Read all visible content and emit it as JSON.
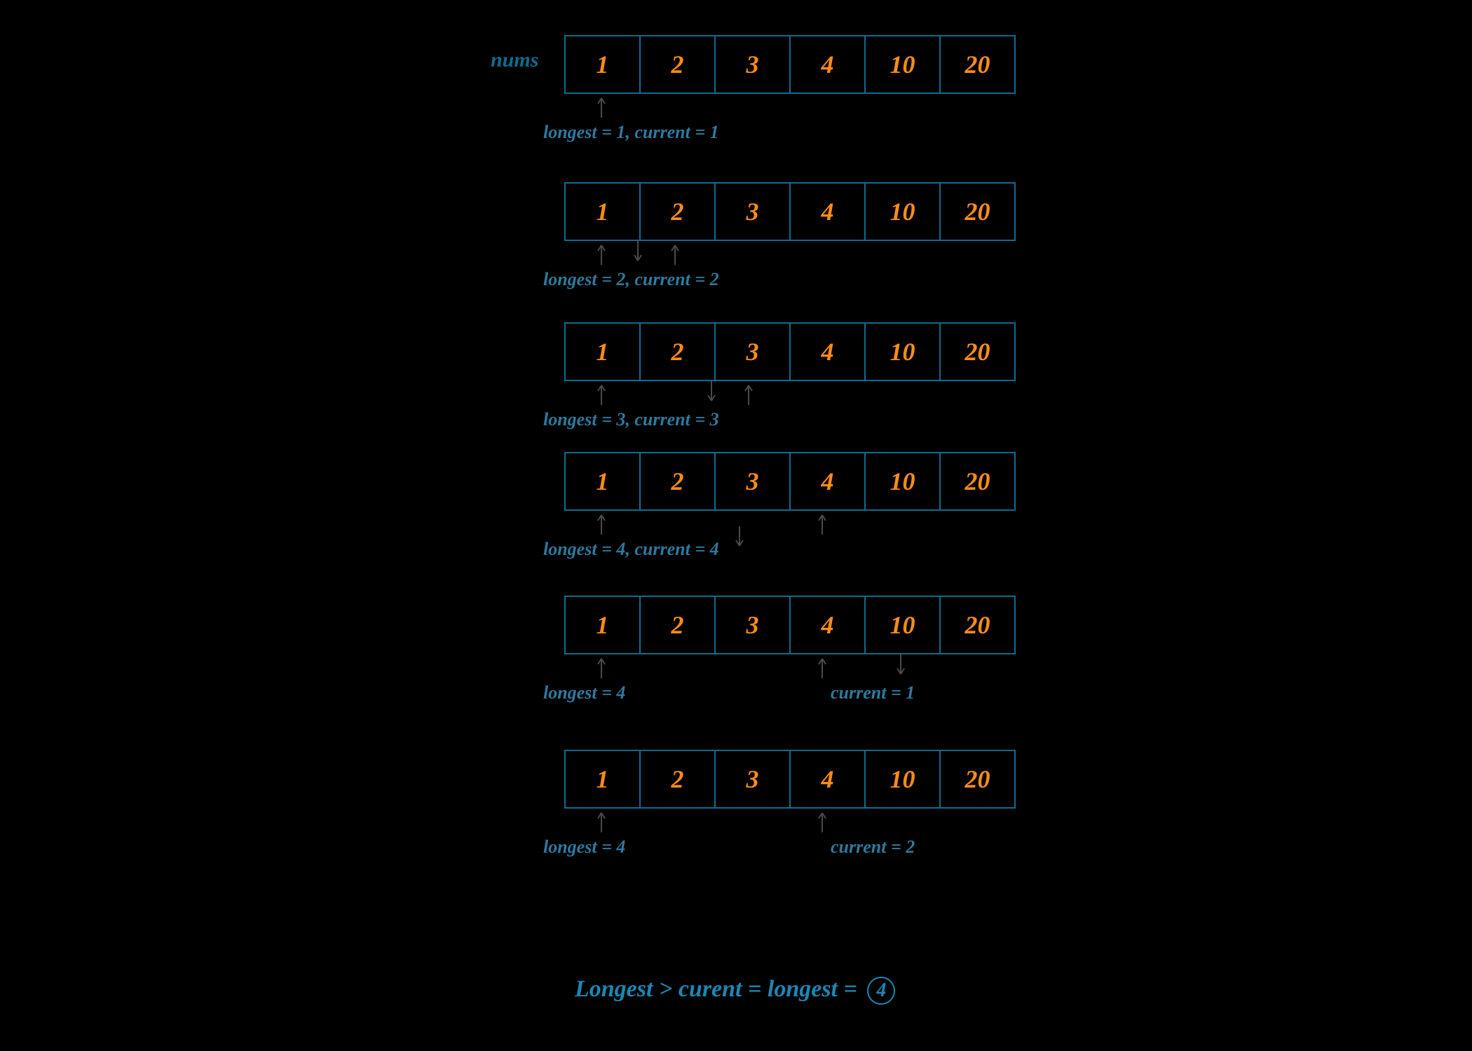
{
  "array_label": "nums",
  "cells": [
    "1",
    "2",
    "3",
    "4",
    "10",
    "20"
  ],
  "steps": [
    {
      "caption": "longest = 1, current = 1",
      "arrow_up_idx": [
        0
      ],
      "arrow_down_idx": [],
      "caption_split": null
    },
    {
      "caption": "longest = 2, current = 2",
      "arrow_up_idx": [
        0,
        1
      ],
      "arrow_down_idx": [
        0.5
      ],
      "caption_split": null
    },
    {
      "caption": "longest = 3, current = 3",
      "arrow_up_idx": [
        0,
        2
      ],
      "arrow_down_idx": [
        1.5
      ],
      "caption_split": null
    },
    {
      "caption": "longest = 4, current = 4",
      "arrow_up_idx": [
        0,
        3
      ],
      "arrow_down_idx": [
        1.5
      ],
      "caption_split": null
    },
    {
      "caption": null,
      "arrow_up_idx": [
        0,
        3
      ],
      "arrow_down_idx": [
        4
      ],
      "caption_split": {
        "left": "longest = 4",
        "right": "current = 1"
      }
    },
    {
      "caption": null,
      "arrow_up_idx": [
        0,
        3
      ],
      "arrow_down_idx": [],
      "caption_split": {
        "left": "longest = 4",
        "right": "current = 2"
      }
    }
  ],
  "final_text_prefix": "Longest > curent = longest = ",
  "final_value": "4"
}
